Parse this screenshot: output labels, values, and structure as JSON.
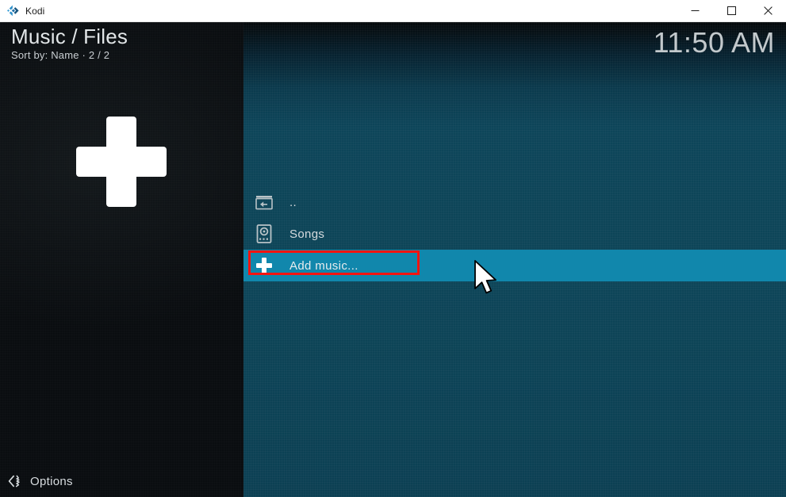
{
  "titlebar": {
    "app_name": "Kodi",
    "logo_icon": "kodi-logo-icon",
    "minimize_label": "Minimize",
    "maximize_label": "Maximize",
    "close_label": "Close"
  },
  "header": {
    "title": "Music / Files",
    "subtitle": "Sort by: Name  ·  2 / 2"
  },
  "clock": {
    "time": "11:50 AM"
  },
  "preview": {
    "icon": "plus-icon"
  },
  "file_list": {
    "items": [
      {
        "label": "..",
        "icon": "parent-folder-icon",
        "selected": false
      },
      {
        "label": "Songs",
        "icon": "hard-drive-icon",
        "selected": false
      },
      {
        "label": "Add music...",
        "icon": "plus-icon",
        "selected": true
      }
    ]
  },
  "footer": {
    "options_label": "Options",
    "options_icon": "settings-chevron-icon"
  },
  "annotation": {
    "type": "highlight-box",
    "color": "#f81410",
    "target": "Add music..."
  },
  "cursor": {
    "icon": "mouse-pointer-icon"
  },
  "colors": {
    "window_chrome": "#ffffff",
    "panel_dark": "#0a0d10",
    "panel_teal": "#0d4559",
    "selection": "#1187ac",
    "accent_red": "#f81410",
    "text_primary": "#d6dbde"
  }
}
